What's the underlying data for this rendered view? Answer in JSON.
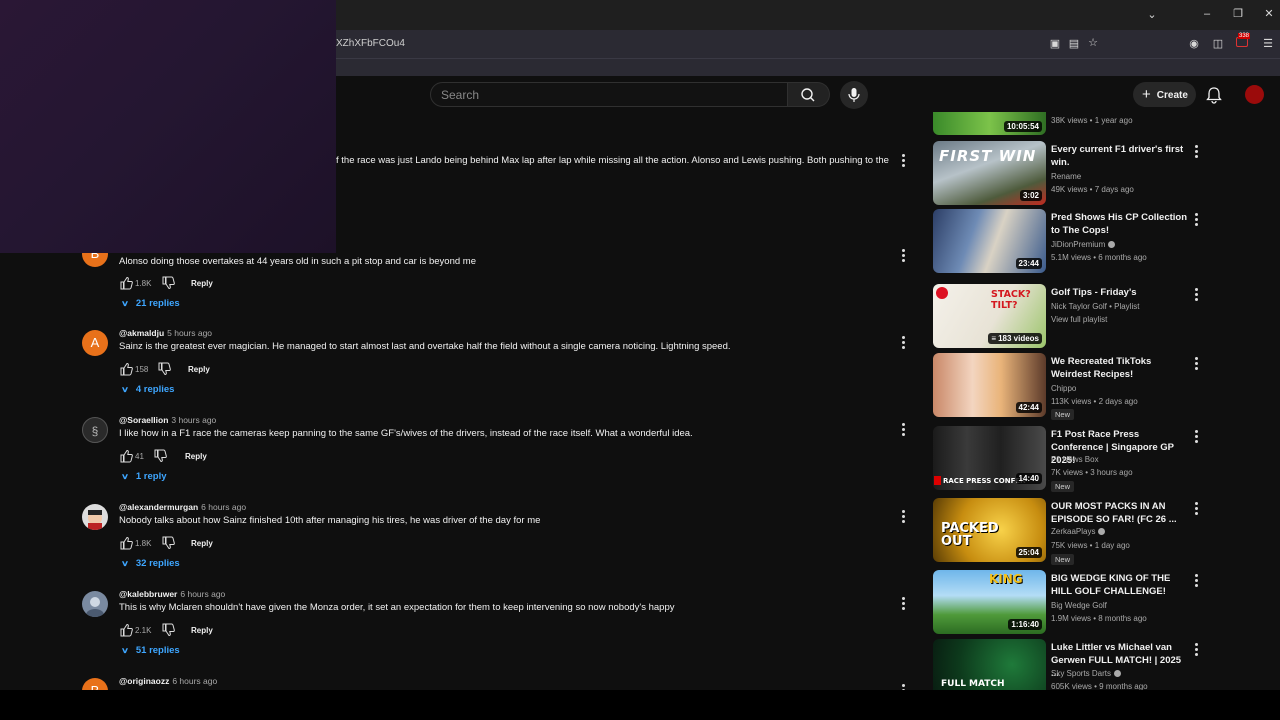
{
  "browser": {
    "url_fragment": "XZhXFbFCOu4",
    "badge_count": "338"
  },
  "header": {
    "search_placeholder": "Search",
    "create_label": "Create"
  },
  "comments": [
    {
      "author": "",
      "time": "",
      "text": "f the race was just Lando being behind Max lap after lap while missing all the action. Alonso and Lewis pushing. Both pushing to the",
      "likes": "",
      "replies": "",
      "avatar_letter": "",
      "avatar_color": ""
    },
    {
      "author": "",
      "time": "",
      "text": "Alonso doing those overtakes at 44 years old in such a pit stop and car is beyond me",
      "likes": "1.8K",
      "replies": "21 replies",
      "avatar_letter": "B",
      "avatar_color": "#e8711a"
    },
    {
      "author": "@akmaldju",
      "time": "5 hours ago",
      "text": "Sainz is the greatest ever magician. He managed to start almost last and overtake half the field without a single camera noticing. Lightning speed.",
      "likes": "158",
      "replies": "4 replies",
      "avatar_letter": "A",
      "avatar_color": "#e8711a"
    },
    {
      "author": "@Soraellion",
      "time": "3 hours ago",
      "text": "I like how in a F1 race the cameras keep panning to the same GF's/wives of the drivers, instead of the race itself. What a wonderful idea.",
      "likes": "41",
      "replies": "1 reply",
      "avatar_letter": "",
      "avatar_color": "#2a2a2a"
    },
    {
      "author": "@alexandermurgan",
      "time": "6 hours ago",
      "text": "Nobody talks about how Sainz finished 10th after managing his tires, he was driver of the day for me",
      "likes": "1.8K",
      "replies": "32 replies",
      "avatar_letter": "",
      "avatar_color": "#c9c9c9"
    },
    {
      "author": "@kalebbruwer",
      "time": "6 hours ago",
      "text": "This is why Mclaren shouldn't have given the Monza order, it set an expectation for them to keep intervening so now nobody's happy",
      "likes": "2.1K",
      "replies": "51 replies",
      "avatar_letter": "",
      "avatar_color": "#7a8aa0"
    },
    {
      "author": "@originaozz",
      "time": "6 hours ago",
      "text": "",
      "likes": "",
      "replies": "",
      "avatar_letter": "B",
      "avatar_color": "#e8711a"
    }
  ],
  "reply_label": "Reply",
  "sidebar": [
    {
      "title": "",
      "channel": "",
      "meta": "38K views • 1 year ago",
      "duration": "10:05:54",
      "new": ""
    },
    {
      "title": "Every current F1 driver's first win.",
      "channel": "Rename",
      "meta": "49K views • 7 days ago",
      "duration": "3:02",
      "new": "",
      "thumb_text": "FIRST WIN"
    },
    {
      "title": "Pred Shows His CP Collection to The Cops!",
      "channel": "JiDionPremium",
      "meta": "5.1M views • 6 months ago",
      "duration": "23:44",
      "new": ""
    },
    {
      "title": "Golf Tips - Friday's",
      "channel": "Nick Taylor Golf • Playlist",
      "meta": "View full playlist",
      "duration": "183 videos",
      "new": "",
      "thumb_text": "STACK? TILT?"
    },
    {
      "title": "We Recreated TikToks Weirdest Recipes!",
      "channel": "Chippo",
      "meta": "113K views • 2 days ago",
      "duration": "42:44",
      "new": "New"
    },
    {
      "title": "F1 Post Race Press Conference | Singapore GP 2025!",
      "channel": "F1 News Box",
      "meta": "7K views • 3 hours ago",
      "duration": "14:40",
      "new": "New",
      "thumb_text": "RACE PRESS CONFER"
    },
    {
      "title": "OUR MOST PACKS IN AN EPISODE SO FAR! (FC 26 ...",
      "channel": "ZerkaaPlays",
      "meta": "75K views • 1 day ago",
      "duration": "25:04",
      "new": "New",
      "thumb_text": "PACKED OUT"
    },
    {
      "title": "BIG WEDGE KING OF THE HILL GOLF CHALLENGE!",
      "channel": "Big Wedge Golf",
      "meta": "1.9M views • 8 months ago",
      "duration": "1:16:40",
      "new": "",
      "thumb_text": "KING"
    },
    {
      "title": "Luke Littler vs Michael van Gerwen FULL MATCH! | 2025 ...",
      "channel": "Sky Sports Darts",
      "meta": "605K views • 9 months ago",
      "duration": "",
      "new": "",
      "thumb_text": "FULL MATCH"
    }
  ],
  "colors": {
    "accent_link": "#3ea6ff",
    "background": "#0f0f0f"
  }
}
